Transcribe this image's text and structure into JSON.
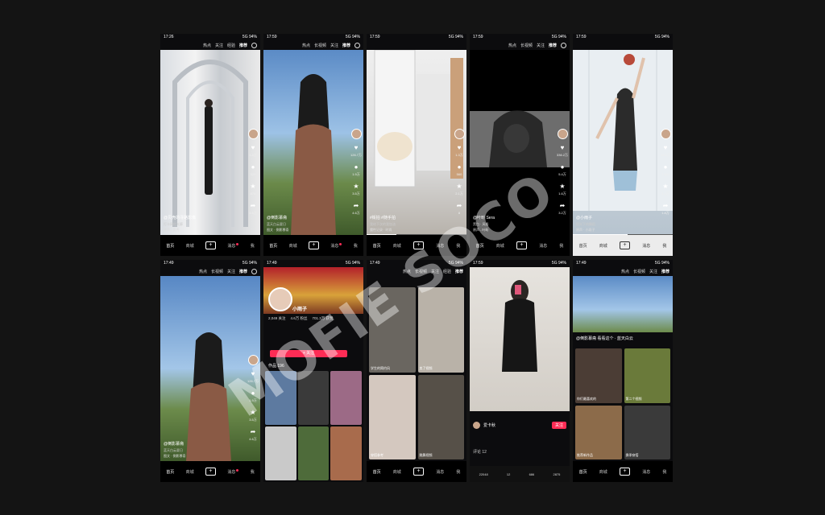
{
  "watermark": "MOFIE SOCO",
  "status": {
    "time": "17:26",
    "signal": "5G 94%"
  },
  "feed_tabs": [
    "热点",
    "长视频",
    "关注",
    "经验",
    "推荐"
  ],
  "bottom_nav": {
    "home": "首页",
    "market": "商城",
    "plus": "+",
    "inbox": "消息",
    "me": "我"
  },
  "phones": [
    {
      "time": "17:26",
      "caption": "@贝壳的寻路影像",
      "sub": "打卡网红光廊",
      "music": "原声 - 贝壳",
      "counts": [
        "1.8万",
        "320",
        "875",
        "4.6万"
      ]
    },
    {
      "time": "17:59",
      "caption": "@倒影慕斋",
      "sub": "蓝天白云夏日",
      "music": "图文 · 倒影慕斋",
      "counts": [
        "126.7万",
        "1.9万",
        "3.5万",
        "4.6万"
      ]
    },
    {
      "time": "17:59",
      "caption": "#街拍  #随手拍",
      "sub": "我给下次的我加油",
      "music": "魔性记录 · 时尚",
      "counts": [
        "1.3万",
        "560",
        "2.1万",
        "8"
      ]
    },
    {
      "time": "17:59",
      "caption": "@叶昕 Sera",
      "sub": "黑白 · 风格",
      "music": "原声 - 叶昕",
      "counts": [
        "336.2万",
        "5.4万",
        "1.6万",
        "3.2万"
      ]
    },
    {
      "time": "17:59",
      "caption": "@小雨子",
      "sub": "阳光下的舞蹈",
      "music": "原声 · 小雨子",
      "counts": [
        "16.1万",
        "1430",
        "1.1万",
        "1.8万"
      ]
    },
    {
      "time": "17:49",
      "caption": "@倒影慕斋",
      "sub": "蓝天白云夏日",
      "music": "图文 · 倒影慕斋",
      "counts": [
        "126.7万",
        "1.9万",
        "3.5万",
        "4.6万"
      ]
    },
    {
      "time": "17:49",
      "profile_name": "小雨子",
      "stats": [
        "2,049 关注",
        "4.6万 粉丝",
        "701.3万 获赞"
      ],
      "follow": "+ 关注",
      "section": "作品 196"
    },
    {
      "time": "17:49",
      "tabs": [
        "热点",
        "长视频",
        "关注",
        "经验",
        "推荐"
      ],
      "cards": [
        "学生的简约风",
        "卖了视频",
        "穿搭参考",
        "跳舞视频"
      ]
    },
    {
      "time": "17:59",
      "name": "爱卡秋",
      "follow": "关注",
      "replies": "评论 12",
      "bar_counts": [
        "22048",
        "12",
        "686",
        "2875"
      ]
    },
    {
      "time": "17:49",
      "caption": "@倒影慕斋",
      "sub": "看看这个 · 蓝天白云",
      "cards": [
        "你们最喜欢的",
        "第二个视频",
        "推荐新作品",
        "换季穿搭"
      ]
    }
  ]
}
